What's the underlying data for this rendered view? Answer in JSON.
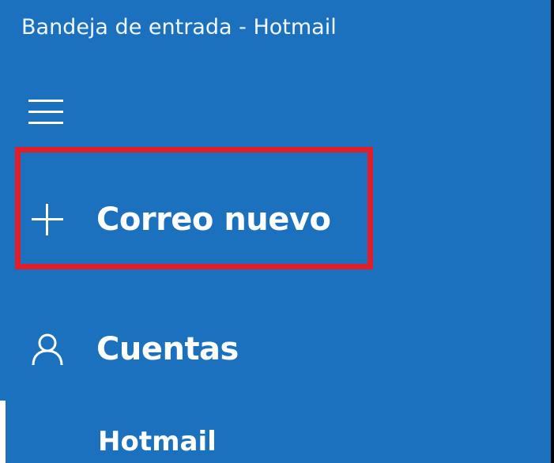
{
  "window": {
    "title": "Bandeja de entrada - Hotmail"
  },
  "colors": {
    "background": "#1c71be",
    "text": "#ffffff",
    "highlight": "#e21d2a"
  },
  "nav": {
    "menu_icon": "hamburger-icon",
    "new_mail": {
      "label": "Correo nuevo",
      "icon": "plus-icon"
    },
    "accounts": {
      "label": "Cuentas",
      "icon": "person-icon"
    }
  },
  "accounts_list": [
    {
      "name": "Hotmail",
      "selected": true
    }
  ]
}
